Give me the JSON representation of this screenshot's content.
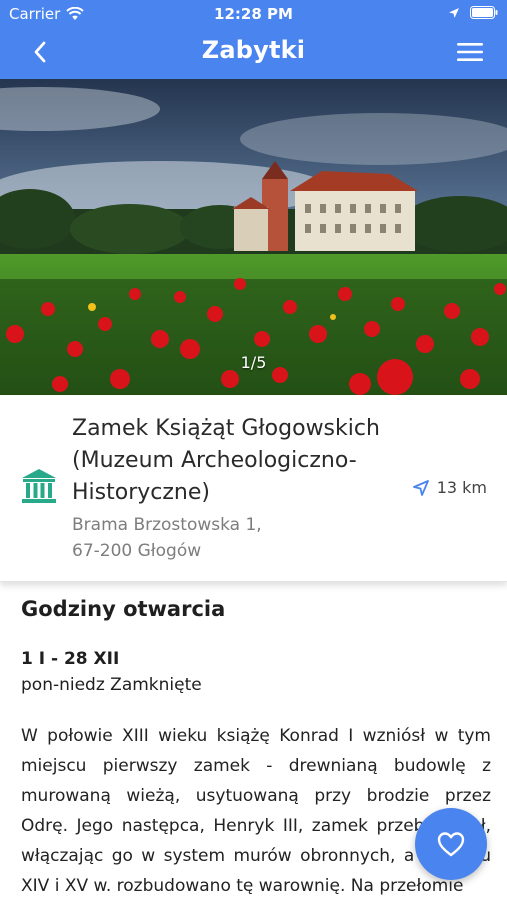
{
  "status": {
    "carrier": "Carrier",
    "time": "12:28 PM"
  },
  "nav": {
    "title": "Zabytki"
  },
  "gallery": {
    "counter": "1/5"
  },
  "place": {
    "name": "Zamek Książąt Głogowskich (Muzeum Archeologiczno-Historyczne)",
    "address_line1": "Brama Brzostowska 1,",
    "address_line2": "67-200 Głogów",
    "distance": "13 km"
  },
  "hours": {
    "heading": "Godziny otwarcia",
    "range": "1 I - 28 XII",
    "days": "pon-niedz Zamknięte"
  },
  "description": "W połowie XIII wieku książę Konrad I wzniósł w tym miejscu pierwszy zamek - drewnianą budowlę z murowaną wieżą, usytuowaną przy brodzie przez Odrę. Jego następca, Henryk III, zamek przebudował, włączając go w system murów obronnych, a w ciągu XIV i XV w. rozbudowano tę warownię. Na przełomie",
  "colors": {
    "accent": "#4a84ee",
    "icon_green": "#27a98a"
  },
  "icons": [
    "wifi-icon",
    "location-arrow-icon",
    "battery-icon",
    "back-chevron-icon",
    "menu-icon",
    "building-icon",
    "navigation-arrow-icon",
    "heart-icon"
  ]
}
